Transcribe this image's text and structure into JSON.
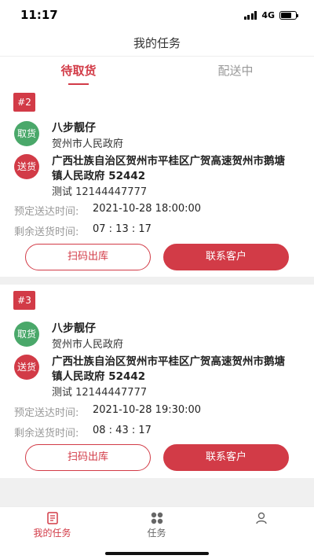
{
  "status_bar": {
    "time": "11:17",
    "network": "4G"
  },
  "header": {
    "title": "我的任务"
  },
  "tabs": [
    {
      "label": "待取货",
      "active": true
    },
    {
      "label": "配送中",
      "active": false
    }
  ],
  "orders": [
    {
      "number": "#2",
      "pickup_badge": "取货",
      "pickup_name": "八步靓仔",
      "pickup_address": "贺州市人民政府",
      "deliver_badge": "送货",
      "deliver_address": "广西壮族自治区贺州市平桂区广贺高速贺州市鹅塘镇人民政府 52442",
      "contact": "测试 12144447777",
      "scheduled_label": "预定送达时间:",
      "scheduled_time": "2021-10-28 18:00:00",
      "remaining_label": "剩余送货时间:",
      "remaining_time": "07 : 13 : 17",
      "scan_button": "扫码出库",
      "contact_button": "联系客户"
    },
    {
      "number": "#3",
      "pickup_badge": "取货",
      "pickup_name": "八步靓仔",
      "pickup_address": "贺州市人民政府",
      "deliver_badge": "送货",
      "deliver_address": "广西壮族自治区贺州市平桂区广贺高速贺州市鹅塘镇人民政府 52442",
      "contact": "测试 12144447777",
      "scheduled_label": "预定送达时间:",
      "scheduled_time": "2021-10-28 19:30:00",
      "remaining_label": "剩余送货时间:",
      "remaining_time": "08 : 43 : 17",
      "scan_button": "扫码出库",
      "contact_button": "联系客户"
    }
  ],
  "bottom_nav": [
    {
      "label": "我的任务",
      "icon": "task-icon",
      "active": true
    },
    {
      "label": "任务",
      "icon": "grid-icon",
      "active": false
    },
    {
      "label": "",
      "icon": "user-icon",
      "active": false
    }
  ],
  "colors": {
    "accent": "#d23b47",
    "pickup": "#4aa86a"
  }
}
